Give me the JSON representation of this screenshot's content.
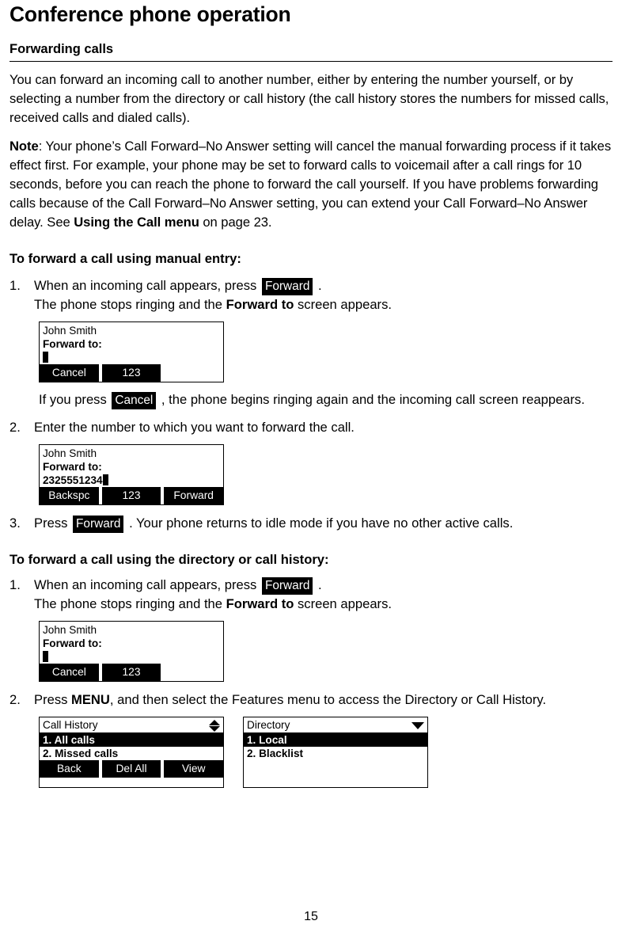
{
  "page": {
    "chapter_title": "Conference phone operation",
    "section_title": "Forwarding calls",
    "folio": "15"
  },
  "intro": {
    "paragraph": "You can forward an incoming call to another number, either by entering the number yourself, or by selecting a number from the directory or call history (the call history stores the numbers for missed calls, received calls and dialed calls).",
    "note_label": "Note",
    "note_part1": ": Your phone’s Call Forward–No Answer setting will cancel the manual forwarding process if it takes effect first. For example, your phone may be set to forward calls to voicemail after a call rings for 10 seconds, before you can reach the phone to forward the call yourself. If you have problems forwarding calls because of the Call Forward–No Answer setting, you can extend your Call Forward–No Answer delay. See ",
    "note_ref_bold": "Using the Call menu",
    "note_part2": " on page 23."
  },
  "manual_entry": {
    "heading": "To forward a call using manual entry:",
    "step1": {
      "num": "1.",
      "text_before": "When an incoming call appears, press ",
      "key": "Forward",
      "text_after": " .",
      "line2_before": "The phone stops ringing and the ",
      "line2_bold": "Forward to",
      "line2_after": " screen appears."
    },
    "cancel_note": {
      "before": "If you press ",
      "key": "Cancel",
      "after": " , the phone begins ringing again and the incoming call screen reappears."
    },
    "step2": {
      "num": "2.",
      "text": "Enter the number to which you want to forward the call."
    },
    "step3": {
      "num": "3.",
      "text_before": "Press ",
      "key": "Forward",
      "text_after": " . Your phone returns to idle mode if you have no other active calls."
    }
  },
  "directory_entry": {
    "heading": "To forward a call using the directory or call history:",
    "step1": {
      "num": "1.",
      "text_before": "When an incoming call appears, press ",
      "key": "Forward",
      "text_after": " .",
      "line2_before": "The phone stops ringing and the ",
      "line2_bold": "Forward to",
      "line2_after": " screen appears."
    },
    "step2": {
      "num": "2.",
      "text_before": "Press ",
      "bold": "MENU",
      "text_after": ", and then select the Features menu to access the Directory or Call History."
    }
  },
  "screens": {
    "forward_empty_1": {
      "caller": "John Smith",
      "prompt": "Forward to:",
      "entry": "",
      "softkeys": [
        "Cancel",
        "123",
        ""
      ]
    },
    "forward_filled": {
      "caller": "John Smith",
      "prompt": "Forward to:",
      "entry": "2325551234",
      "softkeys": [
        "Backspc",
        "123",
        "Forward"
      ]
    },
    "forward_empty_2": {
      "caller": "John Smith",
      "prompt": "Forward to:",
      "entry": "",
      "softkeys": [
        "Cancel",
        "123",
        ""
      ]
    },
    "call_history": {
      "title": "Call History",
      "scroll_icon": "up-down-arrow-icon",
      "items": [
        "1. All calls",
        "2. Missed calls"
      ],
      "selected_index": 0,
      "softkeys": [
        "Back",
        "Del All",
        "View"
      ]
    },
    "directory": {
      "title": "Directory",
      "scroll_icon": "down-arrow-icon",
      "items": [
        "1. Local",
        "2. Blacklist"
      ],
      "selected_index": 0,
      "softkeys": []
    }
  },
  "colors": {
    "ink": "#000000",
    "paper": "#ffffff"
  }
}
